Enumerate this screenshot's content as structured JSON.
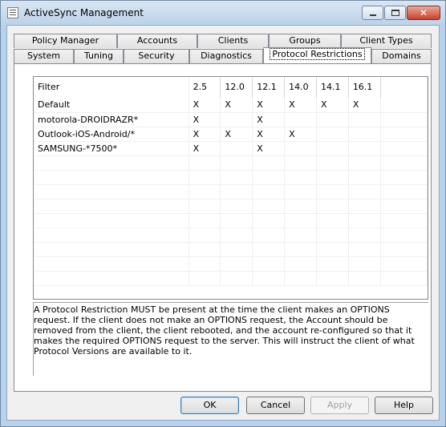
{
  "window": {
    "title": "ActiveSync Management"
  },
  "tabs_back": [
    "Policy Manager",
    "Accounts",
    "Clients",
    "Groups",
    "Client Types"
  ],
  "tabs_front": [
    "System",
    "Tuning",
    "Security",
    "Diagnostics",
    "Protocol Restrictions",
    "Domains"
  ],
  "active_tab": "Protocol Restrictions",
  "grid": {
    "columns": [
      "Filter",
      "2.5",
      "12.0",
      "12.1",
      "14.0",
      "14.1",
      "16.1",
      ""
    ],
    "rows": [
      [
        "Default",
        "X",
        "X",
        "X",
        "X",
        "X",
        "X",
        ""
      ],
      [
        "motorola-DROIDRAZR*",
        "X",
        "",
        "X",
        "",
        "",
        "",
        ""
      ],
      [
        "Outlook-iOS-Android/*",
        "X",
        "X",
        "X",
        "X",
        "",
        "",
        ""
      ],
      [
        "SAMSUNG-*7500*",
        "X",
        "",
        "X",
        "",
        "",
        "",
        ""
      ]
    ],
    "empty_rows": 9
  },
  "description": "A Protocol Restriction MUST be present at the time the client makes an OPTIONS request. If the client does not make an OPTIONS request, the Account should be removed from the client, the client rebooted, and the account re-configured so that it makes the required OPTIONS request to the server. This will instruct the client of what Protocol Versions are available to it.",
  "buttons": {
    "ok": "OK",
    "cancel": "Cancel",
    "apply": "Apply",
    "help": "Help"
  },
  "title_buttons": {
    "close_glyph": "✕"
  }
}
